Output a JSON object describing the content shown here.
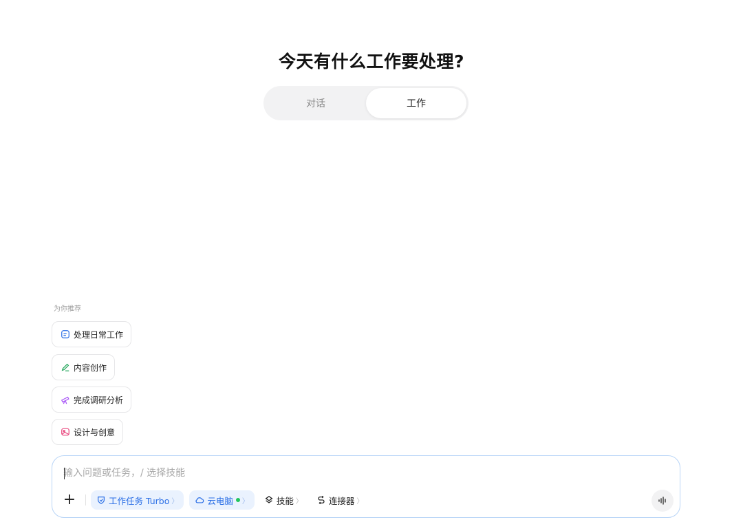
{
  "title": "今天有什么工作要处理?",
  "mode_tabs": [
    {
      "label": "对话",
      "active": false
    },
    {
      "label": "工作",
      "active": true
    }
  ],
  "recommend": {
    "label": "为你推荐",
    "items": [
      {
        "label": "处理日常工作",
        "icon": "document-icon",
        "color": "#2b6fe6"
      },
      {
        "label": "内容创作",
        "icon": "pen-icon",
        "color": "#22a55a"
      },
      {
        "label": "完成调研分析",
        "icon": "telescope-icon",
        "color": "#a855f7"
      },
      {
        "label": "设计与创意",
        "icon": "image-icon",
        "color": "#e8457c"
      }
    ]
  },
  "input": {
    "placeholder": "输入问题或任务，/ 选择技能"
  },
  "toolbar": {
    "add_label": "+",
    "work_task_label": "工作任务 Turbo",
    "cloud_pc_label": "云电脑",
    "skills_label": "技能",
    "connectors_label": "连接器",
    "chevron": "〉",
    "accent_color": "#2b6fe6",
    "status_color": "#22c55e"
  }
}
